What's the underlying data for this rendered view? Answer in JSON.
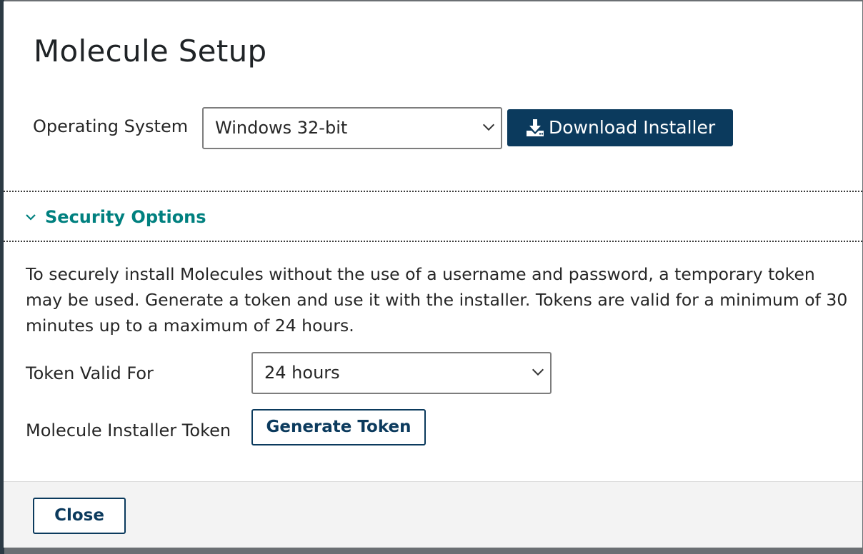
{
  "modal": {
    "title": "Molecule Setup"
  },
  "os": {
    "label": "Operating System",
    "selected": "Windows 32-bit",
    "download_button": "Download Installer"
  },
  "security": {
    "toggle_label": "Security Options",
    "expanded": true,
    "description": "To securely install Molecules without the use of a username and password, a temporary token may be used. Generate a token and use it with the installer. Tokens are valid for a minimum of 30 minutes up to a maximum of 24 hours.",
    "token_valid_label": "Token Valid For",
    "token_valid_selected": "24 hours",
    "installer_token_label": "Molecule Installer Token",
    "generate_button": "Generate Token"
  },
  "footer": {
    "close_button": "Close"
  },
  "icons": {
    "download": "download-icon",
    "select_chevron": "chevron-down-icon",
    "section_chevron": "chevron-down-icon"
  },
  "colors": {
    "primary": "#0b3a5d",
    "section_link": "#00807f",
    "text": "#262626"
  }
}
